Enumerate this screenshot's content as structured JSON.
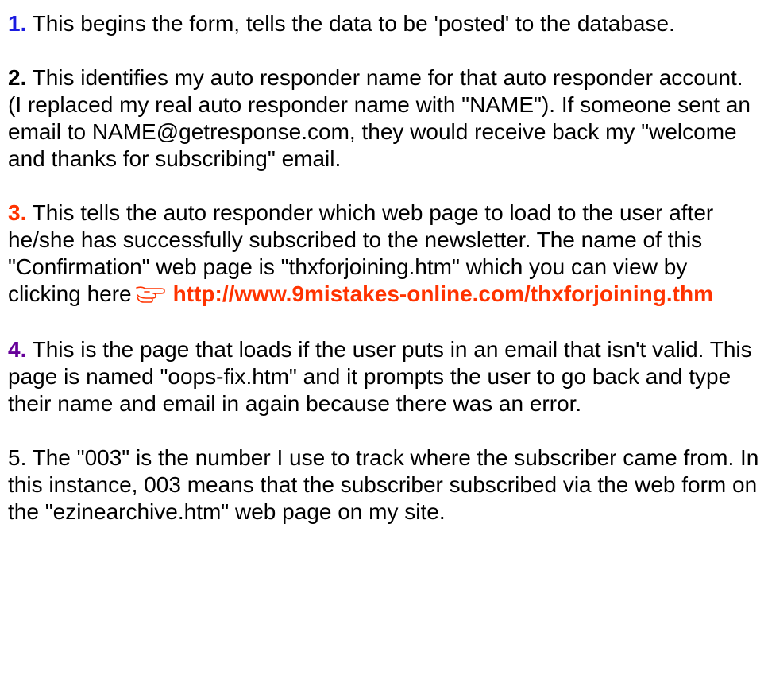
{
  "items": [
    {
      "number": "1.",
      "text": " This begins the form, tells the data to be 'posted' to the database."
    },
    {
      "number": "2.",
      "text": " This identifies my auto responder name for that auto responder account. (I replaced my real auto responder name with \"NAME\"). If someone sent an email to NAME@getresponse.com, they would receive back my \"welcome and thanks for subscribing\" email."
    },
    {
      "number": "3.",
      "text": " This tells the auto responder which web page to load to the user after he/she has successfully subscribed to the newsletter. The name of this \"Confirmation\" web page is \"thxforjoining.htm\" which you can view by clicking here",
      "link_icon": "pointing-hand-icon",
      "link_text": "http://www.9mistakes-online.com/thxforjoining.thm"
    },
    {
      "number": "4.",
      "text": " This is the page that loads if the user puts in an email that isn't valid. This page is named \"oops-fix.htm\" and it prompts the user to go back and type their name and email in again because there was an error."
    },
    {
      "text": "5. The \"003\" is the number I use to track where the subscriber came from. In this instance, 003 means that the subscriber subscribed via the web form on the \"ezinearchive.htm\" web page on my site."
    }
  ],
  "colors": {
    "item1_number": "#1b1be0",
    "item2_number": "#000000",
    "item3_number": "#ff3300",
    "item4_number": "#660099",
    "link": "#ff3300"
  }
}
